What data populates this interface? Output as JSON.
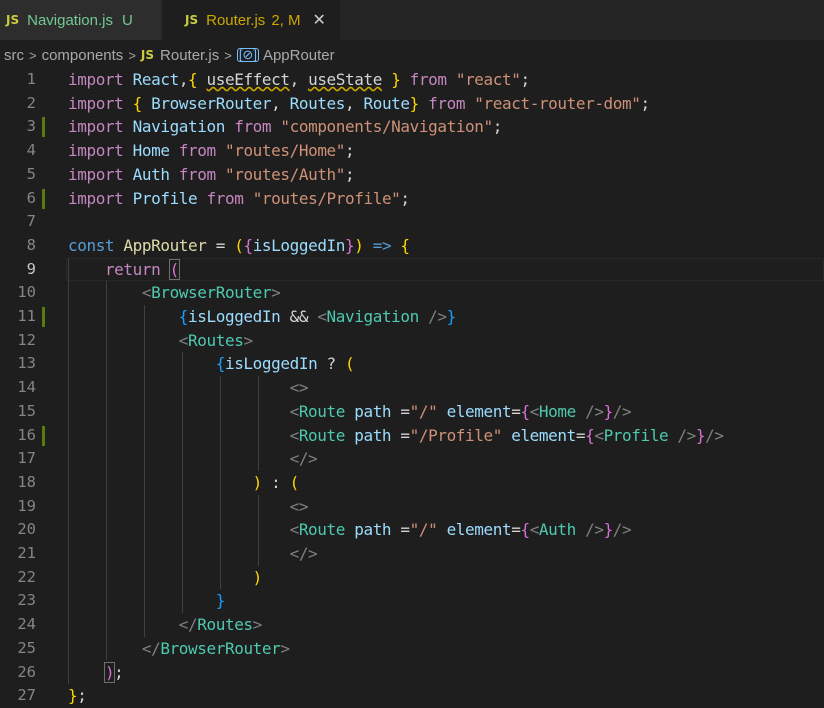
{
  "tabs": [
    {
      "badge": "JS",
      "name": "Navigation.js",
      "status": "U",
      "active": false
    },
    {
      "badge": "JS",
      "name": "Router.js",
      "status": "2, M",
      "close": "✕",
      "active": true
    }
  ],
  "breadcrumb": {
    "parts": [
      "src",
      "components",
      "Router.js",
      "AppRouter"
    ],
    "js_badge": "JS",
    "symbol_glyph": "[⊘]"
  },
  "editor": {
    "current_line": 9,
    "modified_lines": [
      3,
      6,
      11,
      16
    ],
    "lines": [
      {
        "n": "1",
        "tokens": [
          [
            "kc",
            "import "
          ],
          [
            "vr",
            "React"
          ],
          [
            "",
            ","
          ],
          [
            "b1",
            "{ "
          ],
          [
            "sq",
            "useEffect"
          ],
          [
            "",
            ", "
          ],
          [
            "sq",
            "useState"
          ],
          [
            "b1",
            " }"
          ],
          [
            "kc",
            " from "
          ],
          [
            "st",
            "\"react\""
          ],
          [
            "",
            ";"
          ]
        ]
      },
      {
        "n": "2",
        "tokens": [
          [
            "kc",
            "import "
          ],
          [
            "b1",
            "{ "
          ],
          [
            "vr",
            "BrowserRouter"
          ],
          [
            "",
            ", "
          ],
          [
            "vr",
            "Routes"
          ],
          [
            "",
            ", "
          ],
          [
            "vr",
            "Route"
          ],
          [
            "b1",
            "}"
          ],
          [
            "kc",
            " from "
          ],
          [
            "st",
            "\"react-router-dom\""
          ],
          [
            "",
            ";"
          ]
        ]
      },
      {
        "n": "3",
        "tokens": [
          [
            "kc",
            "import "
          ],
          [
            "vr",
            "Navigation"
          ],
          [
            "kc",
            " from "
          ],
          [
            "st",
            "\"components/Navigation\""
          ],
          [
            "",
            ";"
          ]
        ]
      },
      {
        "n": "4",
        "tokens": [
          [
            "kc",
            "import "
          ],
          [
            "vr",
            "Home"
          ],
          [
            "kc",
            " from "
          ],
          [
            "st",
            "\"routes/Home\""
          ],
          [
            "",
            ";"
          ]
        ]
      },
      {
        "n": "5",
        "tokens": [
          [
            "kc",
            "import "
          ],
          [
            "vr",
            "Auth"
          ],
          [
            "kc",
            " from "
          ],
          [
            "st",
            "\"routes/Auth\""
          ],
          [
            "",
            ";"
          ]
        ]
      },
      {
        "n": "6",
        "tokens": [
          [
            "kc",
            "import "
          ],
          [
            "vr",
            "Profile"
          ],
          [
            "kc",
            " from "
          ],
          [
            "st",
            "\"routes/Profile\""
          ],
          [
            "",
            ";"
          ]
        ]
      },
      {
        "n": "7",
        "tokens": []
      },
      {
        "n": "8",
        "tokens": [
          [
            "kw",
            "const "
          ],
          [
            "fn",
            "AppRouter"
          ],
          [
            "",
            " = "
          ],
          [
            "b1",
            "("
          ],
          [
            "b2",
            "{"
          ],
          [
            "vr",
            "isLoggedIn"
          ],
          [
            "b2",
            "}"
          ],
          [
            "b1",
            ")"
          ],
          [
            "kw",
            " =>"
          ],
          [
            "b1",
            " {"
          ]
        ]
      },
      {
        "n": "9",
        "tokens": [
          [
            "",
            "    "
          ],
          [
            "kc",
            "return "
          ],
          [
            "b2bm",
            "("
          ]
        ]
      },
      {
        "n": "10",
        "tokens": [
          [
            "",
            "        "
          ],
          [
            "gy",
            "<"
          ],
          [
            "tg",
            "BrowserRouter"
          ],
          [
            "gy",
            ">"
          ]
        ]
      },
      {
        "n": "11",
        "tokens": [
          [
            "",
            "            "
          ],
          [
            "b3",
            "{"
          ],
          [
            "vr",
            "isLoggedIn"
          ],
          [
            "",
            " && "
          ],
          [
            "gy",
            "<"
          ],
          [
            "tg",
            "Navigation"
          ],
          [
            "gy",
            " />"
          ],
          [
            "b3",
            "}"
          ]
        ]
      },
      {
        "n": "12",
        "tokens": [
          [
            "",
            "            "
          ],
          [
            "gy",
            "<"
          ],
          [
            "tg",
            "Routes"
          ],
          [
            "gy",
            ">"
          ]
        ]
      },
      {
        "n": "13",
        "tokens": [
          [
            "",
            "                "
          ],
          [
            "b3",
            "{"
          ],
          [
            "vr",
            "isLoggedIn"
          ],
          [
            "",
            " ? "
          ],
          [
            "b1",
            "("
          ]
        ]
      },
      {
        "n": "14",
        "tokens": [
          [
            "",
            "                        "
          ],
          [
            "gy",
            "<>"
          ]
        ]
      },
      {
        "n": "15",
        "tokens": [
          [
            "",
            "                        "
          ],
          [
            "gy",
            "<"
          ],
          [
            "tg",
            "Route"
          ],
          [
            "vr",
            " path"
          ],
          [
            "",
            " ="
          ],
          [
            "st",
            "\"/\""
          ],
          [
            "vr",
            " element"
          ],
          [
            "",
            "="
          ],
          [
            "b2",
            "{"
          ],
          [
            "gy",
            "<"
          ],
          [
            "tg",
            "Home"
          ],
          [
            "gy",
            " />"
          ],
          [
            "b2",
            "}"
          ],
          [
            "gy",
            "/>"
          ]
        ]
      },
      {
        "n": "16",
        "tokens": [
          [
            "",
            "                        "
          ],
          [
            "gy",
            "<"
          ],
          [
            "tg",
            "Route"
          ],
          [
            "vr",
            " path"
          ],
          [
            "",
            " ="
          ],
          [
            "st",
            "\"/Profile\""
          ],
          [
            "vr",
            " element"
          ],
          [
            "",
            "="
          ],
          [
            "b2",
            "{"
          ],
          [
            "gy",
            "<"
          ],
          [
            "tg",
            "Profile"
          ],
          [
            "gy",
            " />"
          ],
          [
            "b2",
            "}"
          ],
          [
            "gy",
            "/>"
          ]
        ]
      },
      {
        "n": "17",
        "tokens": [
          [
            "",
            "                        "
          ],
          [
            "gy",
            "</>"
          ]
        ]
      },
      {
        "n": "18",
        "tokens": [
          [
            "",
            "                    "
          ],
          [
            "b1",
            ")"
          ],
          [
            "",
            " : "
          ],
          [
            "b1",
            "("
          ]
        ]
      },
      {
        "n": "19",
        "tokens": [
          [
            "",
            "                        "
          ],
          [
            "gy",
            "<>"
          ]
        ]
      },
      {
        "n": "20",
        "tokens": [
          [
            "",
            "                        "
          ],
          [
            "gy",
            "<"
          ],
          [
            "tg",
            "Route"
          ],
          [
            "vr",
            " path"
          ],
          [
            "",
            " ="
          ],
          [
            "st",
            "\"/\""
          ],
          [
            "vr",
            " element"
          ],
          [
            "",
            "="
          ],
          [
            "b2",
            "{"
          ],
          [
            "gy",
            "<"
          ],
          [
            "tg",
            "Auth"
          ],
          [
            "gy",
            " />"
          ],
          [
            "b2",
            "}"
          ],
          [
            "gy",
            "/>"
          ]
        ]
      },
      {
        "n": "21",
        "tokens": [
          [
            "",
            "                        "
          ],
          [
            "gy",
            "</>"
          ]
        ]
      },
      {
        "n": "22",
        "tokens": [
          [
            "",
            "                    "
          ],
          [
            "b1",
            ")"
          ]
        ]
      },
      {
        "n": "23",
        "tokens": [
          [
            "",
            "                "
          ],
          [
            "b3",
            "}"
          ]
        ]
      },
      {
        "n": "24",
        "tokens": [
          [
            "",
            "            "
          ],
          [
            "gy",
            "</"
          ],
          [
            "tg",
            "Routes"
          ],
          [
            "gy",
            ">"
          ]
        ]
      },
      {
        "n": "25",
        "tokens": [
          [
            "",
            "        "
          ],
          [
            "gy",
            "</"
          ],
          [
            "tg",
            "BrowserRouter"
          ],
          [
            "gy",
            ">"
          ]
        ]
      },
      {
        "n": "26",
        "tokens": [
          [
            "",
            "    "
          ],
          [
            "b2bm",
            ")"
          ],
          [
            "",
            ";"
          ]
        ]
      },
      {
        "n": "27",
        "tokens": [
          [
            "b1",
            "}"
          ],
          [
            "",
            ";"
          ]
        ]
      }
    ]
  }
}
